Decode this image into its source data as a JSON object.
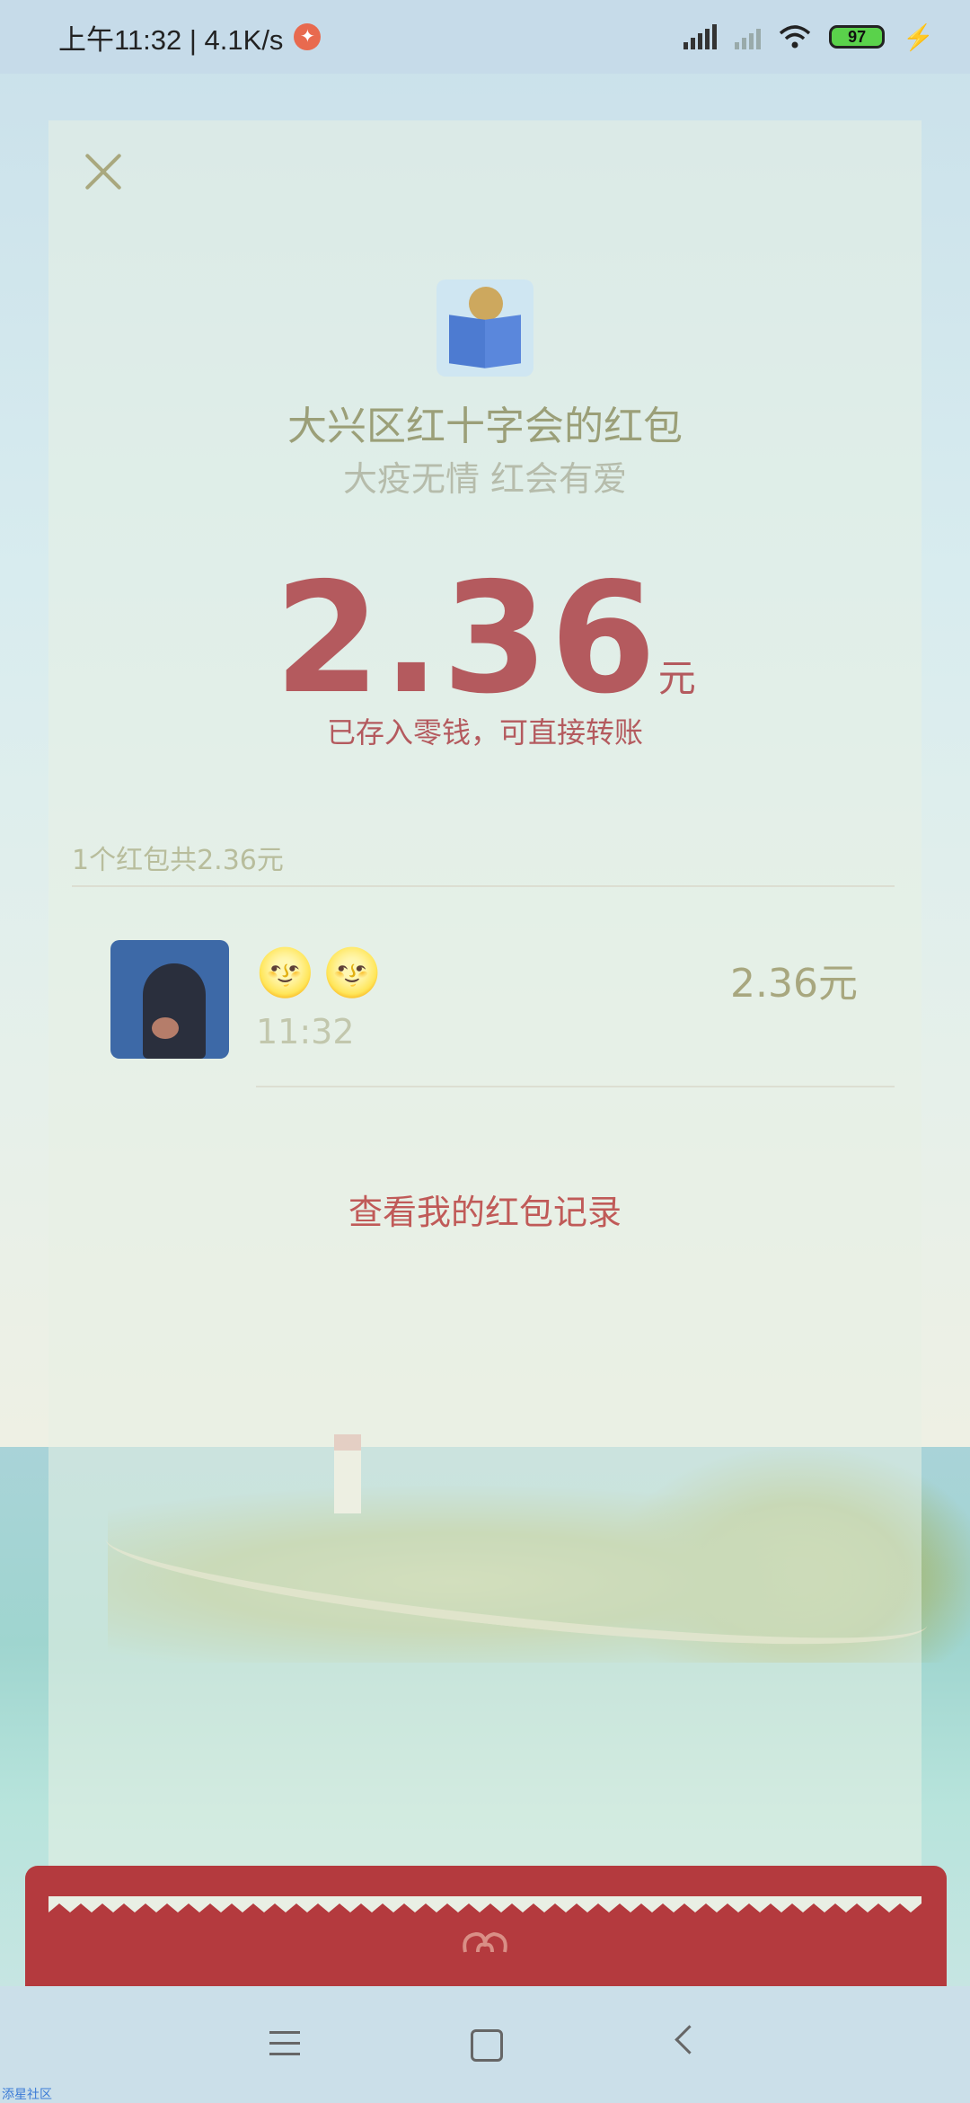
{
  "status_bar": {
    "time_speed": "上午11:32 | 4.1K/s",
    "battery": "97"
  },
  "envelope": {
    "title": "大兴区红十字会的红包",
    "subtitle": "大疫无情 红会有爱",
    "amount": "2.36",
    "unit": "元",
    "stored_note": "已存入零钱，可直接转账",
    "summary": "1个红包共2.36元"
  },
  "recipient": {
    "name_emojis": "🌝🌝",
    "time": "11:32",
    "amount": "2.36元"
  },
  "records_link": "查看我的红包记录",
  "watermark": "添星社区",
  "colors": {
    "accent_red": "#b45a5e",
    "envelope_red": "#b43a3e"
  }
}
